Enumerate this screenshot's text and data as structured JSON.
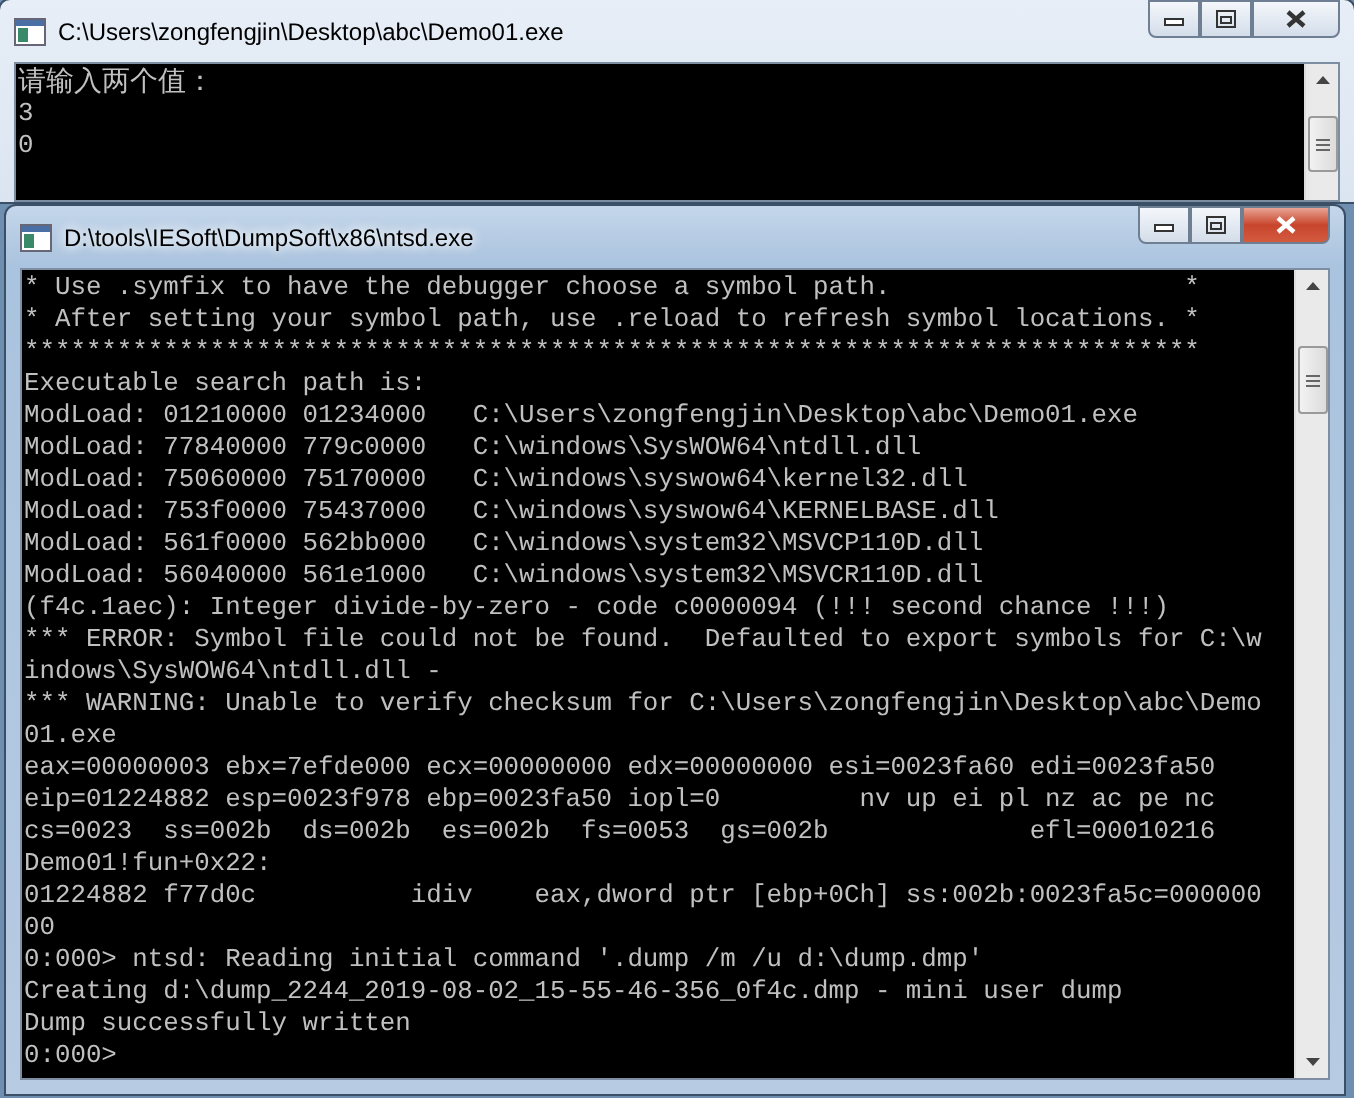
{
  "windows": [
    {
      "title": "C:\\Users\\zongfengjin\\Desktop\\abc\\Demo01.exe",
      "active": false,
      "lines": [
        "请输入两个值：",
        "3",
        "0"
      ]
    },
    {
      "title": "D:\\tools\\IESoft\\DumpSoft\\x86\\ntsd.exe",
      "active": true,
      "lines": [
        "* Use .symfix to have the debugger choose a symbol path.                   *",
        "* After setting your symbol path, use .reload to refresh symbol locations. *",
        "****************************************************************************",
        "Executable search path is:",
        "ModLoad: 01210000 01234000   C:\\Users\\zongfengjin\\Desktop\\abc\\Demo01.exe",
        "ModLoad: 77840000 779c0000   C:\\windows\\SysWOW64\\ntdll.dll",
        "ModLoad: 75060000 75170000   C:\\windows\\syswow64\\kernel32.dll",
        "ModLoad: 753f0000 75437000   C:\\windows\\syswow64\\KERNELBASE.dll",
        "ModLoad: 561f0000 562bb000   C:\\windows\\system32\\MSVCP110D.dll",
        "ModLoad: 56040000 561e1000   C:\\windows\\system32\\MSVCR110D.dll",
        "(f4c.1aec): Integer divide-by-zero - code c0000094 (!!! second chance !!!)",
        "*** ERROR: Symbol file could not be found.  Defaulted to export symbols for C:\\w",
        "indows\\SysWOW64\\ntdll.dll -",
        "*** WARNING: Unable to verify checksum for C:\\Users\\zongfengjin\\Desktop\\abc\\Demo",
        "01.exe",
        "eax=00000003 ebx=7efde000 ecx=00000000 edx=00000000 esi=0023fa60 edi=0023fa50",
        "eip=01224882 esp=0023f978 ebp=0023fa50 iopl=0         nv up ei pl nz ac pe nc",
        "cs=0023  ss=002b  ds=002b  es=002b  fs=0053  gs=002b             efl=00010216",
        "Demo01!fun+0x22:",
        "01224882 f77d0c          idiv    eax,dword ptr [ebp+0Ch] ss:002b:0023fa5c=000000",
        "00",
        "0:000> ntsd: Reading initial command '.dump /m /u d:\\dump.dmp'",
        "Creating d:\\dump_2244_2019-08-02_15-55-46-356_0f4c.dmp - mini user dump",
        "Dump successfully written",
        "0:000>"
      ]
    }
  ]
}
